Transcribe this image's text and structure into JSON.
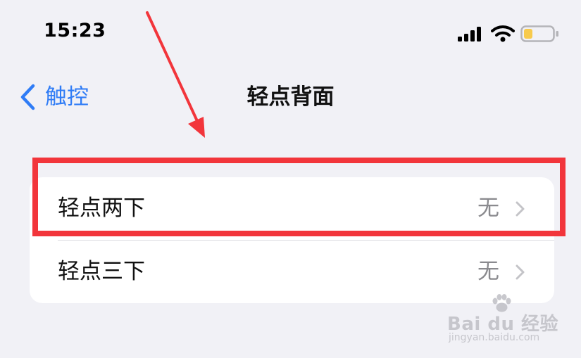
{
  "status_bar": {
    "time": "15:23",
    "icons": [
      "signal-icon",
      "wifi-icon",
      "battery-icon"
    ],
    "battery_level": 0.3,
    "battery_color": "#f7ca4c"
  },
  "nav": {
    "back_label": "触控",
    "title": "轻点背面",
    "accent_color": "#2f7cf6"
  },
  "settings_list": [
    {
      "label": "轻点两下",
      "value": "无",
      "highlighted": true
    },
    {
      "label": "轻点三下",
      "value": "无",
      "highlighted": false
    }
  ],
  "annotation": {
    "color": "#f2353b"
  },
  "watermark": {
    "text": "Bai du 经验",
    "url": "jingyan.baidu.com"
  }
}
